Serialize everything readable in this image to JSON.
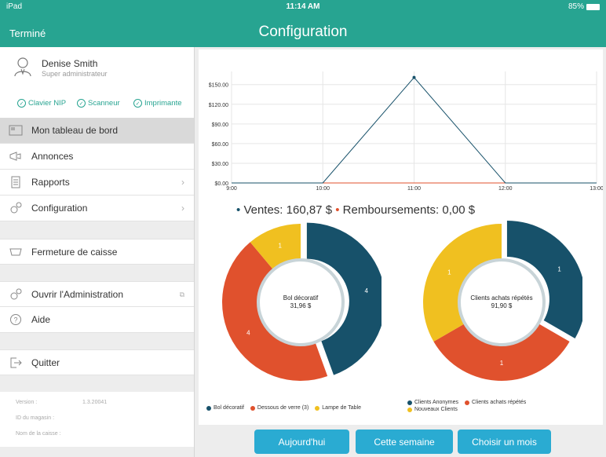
{
  "status_bar": {
    "device": "iPad",
    "time": "11:14 AM",
    "battery": "85%"
  },
  "header": {
    "done_label": "Terminé",
    "title": "Configuration"
  },
  "user": {
    "name": "Denise Smith",
    "role": "Super administrateur"
  },
  "devices": [
    {
      "label": "Clavier NIP"
    },
    {
      "label": "Scanneur"
    },
    {
      "label": "Imprimante"
    }
  ],
  "menu": {
    "dashboard": "Mon tableau de bord",
    "announcements": "Annonces",
    "reports": "Rapports",
    "configuration": "Configuration",
    "close_register": "Fermeture de caisse",
    "open_admin": "Ouvrir l'Administration",
    "help": "Aide",
    "quit": "Quitter"
  },
  "version_info": {
    "version_label": "Version :",
    "version_value": "1.3.20041",
    "store_id_label": "ID du magasin :",
    "register_label": "Nom de la caisse :"
  },
  "line_chart": {
    "type": "line",
    "x": [
      "9:00",
      "10:00",
      "11:00",
      "12:00",
      "13:00"
    ],
    "series": [
      {
        "values": [
          0,
          0,
          160.87,
          0,
          0
        ],
        "color": "#17516a"
      },
      {
        "values": [
          0,
          0,
          0,
          0,
          0
        ],
        "color": "#e0512d"
      }
    ],
    "yticks": [
      "$0.00",
      "$30.00",
      "$60.00",
      "$90.00",
      "$120.00",
      "$150.00"
    ],
    "ylim": [
      0,
      170
    ]
  },
  "summary": {
    "sales": "Ventes: 160,87 $",
    "refunds": "Remboursements: 0,00 $"
  },
  "chart_data": [
    {
      "type": "pie",
      "center_title": "Bol décoratif",
      "center_value": "31,96 $",
      "categories": [
        "Bol décoratif",
        "Dessous de verre (3)",
        "Lampe de Table"
      ],
      "values": [
        4,
        4,
        1
      ],
      "colors": [
        "#17516a",
        "#e0512d",
        "#f0c020"
      ]
    },
    {
      "type": "pie",
      "center_title": "Clients achats répétés",
      "center_value": "91,90 $",
      "categories": [
        "Clients Anonymes",
        "Clients achats répétés",
        "Nouveaux Clients"
      ],
      "values": [
        1,
        1,
        1
      ],
      "colors": [
        "#17516a",
        "#e0512d",
        "#f0c020"
      ]
    }
  ],
  "buttons": {
    "today": "Aujourd'hui",
    "week": "Cette semaine",
    "month": "Choisir un mois"
  }
}
